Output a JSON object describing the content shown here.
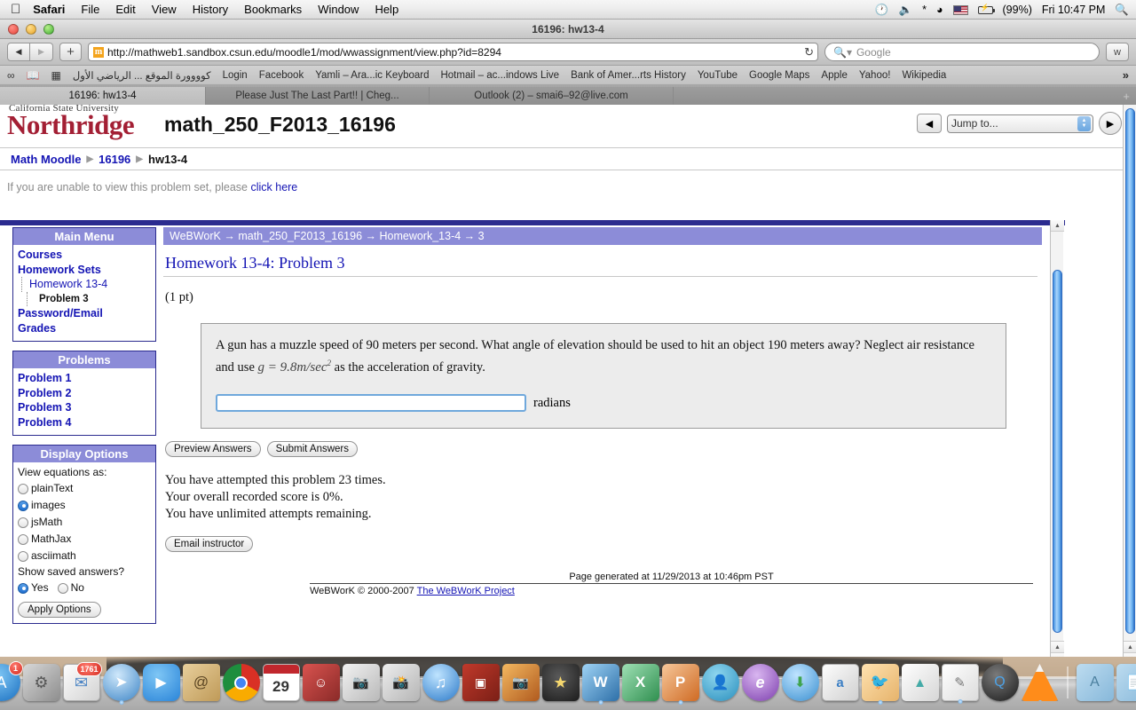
{
  "menubar": {
    "apple_icon": "apple-icon",
    "items": [
      "Safari",
      "File",
      "Edit",
      "View",
      "History",
      "Bookmarks",
      "Window",
      "Help"
    ],
    "status": {
      "timemachine_icon": "clock-icon",
      "volume_icon": "volume-icon",
      "bluetooth_icon": "bluetooth-icon",
      "wifi_icon": "wifi-icon",
      "flag_icon": "us-flag-icon",
      "battery_icon": "battery-icon",
      "battery_percent": "(99%)",
      "clock": "Fri 10:47 PM",
      "spotlight_icon": "search-icon"
    }
  },
  "window": {
    "title": "16196: hw13-4",
    "close_button": "close-button",
    "minimize_button": "minimize-button",
    "zoom_button": "zoom-button"
  },
  "toolbar": {
    "back_label": "◀",
    "forward_label": "▶",
    "add_label": "+",
    "url": "http://mathweb1.sandbox.csun.edu/moodle1/mod/wwassignment/view.php?id=8294",
    "favicon_letter": "m",
    "reload_label": "↻",
    "search_placeholder": "Google",
    "search_icon": "magnifier-icon",
    "reader_label": "ᴡ"
  },
  "bookmarks_bar": {
    "icons": [
      "reading-glasses-icon",
      "book-icon",
      "grid-icon"
    ],
    "items": [
      "كوووورة الموقع ... الرياضي الأول",
      "Login",
      "Facebook",
      "Yamli – Ara...ic Keyboard",
      "Hotmail – ac...indows Live",
      "Bank of Amer...rts History",
      "YouTube",
      "Google Maps",
      "Apple",
      "Yahoo!",
      "Wikipedia"
    ],
    "overflow": "»"
  },
  "tabs": {
    "items": [
      {
        "label": "16196: hw13-4",
        "active": true
      },
      {
        "label": "Please Just The Last Part!! | Cheg...",
        "active": false
      },
      {
        "label": "Outlook (2) – smai6–92@live.com",
        "active": false
      }
    ],
    "new_tab_label": "+"
  },
  "site_header": {
    "university_line1": "California State University",
    "university_line2": "Northridge",
    "course_title": "math_250_F2013_16196",
    "jump_prev_label": "◀",
    "jump_select_value": "Jump to...",
    "jump_next_label": "▶"
  },
  "breadcrumb": {
    "items": [
      "Math Moodle",
      "16196"
    ],
    "current": "hw13-4",
    "separator": "▶"
  },
  "notice": {
    "text": "If you are unable to view this problem set, please ",
    "link": "click here"
  },
  "webwork": {
    "trail": "WeBWorK → math_250_F2013_16196 → Homework_13-4 → 3",
    "title": "Homework 13-4: Problem 3",
    "points": "(1 pt)",
    "problem_text_1": "A gun has a muzzle speed of 90 meters per second. What angle of elevation should be used to hit an object 190 meters away? Neglect air resistance and use ",
    "problem_math": "g = 9.8m/sec",
    "problem_math_sup": "2",
    "problem_text_2": " as the acceleration of gravity.",
    "answer_value": "",
    "answer_unit": "radians",
    "preview_label": "Preview Answers",
    "submit_label": "Submit Answers",
    "status_line_1": "You have attempted this problem 23 times.",
    "status_line_2": "Your overall recorded score is 0%.",
    "status_line_3": "You have unlimited attempts remaining.",
    "email_label": "Email instructor",
    "footer_generated": "Page generated at 11/29/2013 at 10:46pm PST",
    "footer_copy": "WeBWorK © 2000-2007 ",
    "footer_link": "The WeBWorK Project"
  },
  "main_menu": {
    "header": "Main Menu",
    "items": [
      {
        "label": "Courses",
        "level": 0
      },
      {
        "label": "Homework Sets",
        "level": 0
      },
      {
        "label": "Homework 13-4",
        "level": 1
      },
      {
        "label": "Problem 3",
        "level": 2
      },
      {
        "label": "Password/Email",
        "level": 0
      },
      {
        "label": "Grades",
        "level": 0
      }
    ]
  },
  "problems_menu": {
    "header": "Problems",
    "items": [
      "Problem 1",
      "Problem 2",
      "Problem 3",
      "Problem 4"
    ]
  },
  "display_options": {
    "header": "Display Options",
    "view_label": "View equations as:",
    "view_options": [
      {
        "label": "plainText",
        "selected": false
      },
      {
        "label": "images",
        "selected": true
      },
      {
        "label": "jsMath",
        "selected": false
      },
      {
        "label": "MathJax",
        "selected": false
      },
      {
        "label": "asciimath",
        "selected": false
      }
    ],
    "saved_label": "Show saved answers?",
    "saved_options": [
      {
        "label": "Yes",
        "selected": true
      },
      {
        "label": "No",
        "selected": false
      }
    ],
    "apply_label": "Apply Options"
  },
  "dock": {
    "items": [
      {
        "name": "finder",
        "badge": null
      },
      {
        "name": "dashboard",
        "badge": null
      },
      {
        "name": "app-store",
        "badge": "1"
      },
      {
        "name": "system-preferences",
        "badge": null
      },
      {
        "name": "mail",
        "badge": "1761"
      },
      {
        "name": "safari",
        "badge": null
      },
      {
        "name": "facetime",
        "badge": null
      },
      {
        "name": "address-book",
        "badge": null
      },
      {
        "name": "google-chrome",
        "badge": null
      },
      {
        "name": "calendar",
        "badge": "29"
      },
      {
        "name": "photo-booth",
        "badge": null
      },
      {
        "name": "iphoto",
        "badge": null
      },
      {
        "name": "image-capture",
        "badge": null
      },
      {
        "name": "itunes",
        "badge": null
      },
      {
        "name": "photos-folder",
        "badge": null
      },
      {
        "name": "preview",
        "badge": null
      },
      {
        "name": "imovie",
        "badge": null
      },
      {
        "name": "microsoft-word",
        "badge": null
      },
      {
        "name": "microsoft-excel",
        "badge": null
      },
      {
        "name": "microsoft-powerpoint",
        "badge": null
      },
      {
        "name": "msn-messenger",
        "badge": null
      },
      {
        "name": "internet-explorer",
        "badge": null
      },
      {
        "name": "firefox-download",
        "badge": null
      },
      {
        "name": "pages",
        "badge": null
      },
      {
        "name": "angry-birds",
        "badge": null
      },
      {
        "name": "grapher",
        "badge": null
      },
      {
        "name": "textedit",
        "badge": null
      },
      {
        "name": "quicktime",
        "badge": null
      },
      {
        "name": "vlc",
        "badge": null
      },
      {
        "name": "applications-folder",
        "badge": null
      },
      {
        "name": "documents-folder",
        "badge": null
      },
      {
        "name": "downloads-stack",
        "badge": null
      },
      {
        "name": "trash",
        "badge": null
      }
    ],
    "calendar_day": "29"
  }
}
